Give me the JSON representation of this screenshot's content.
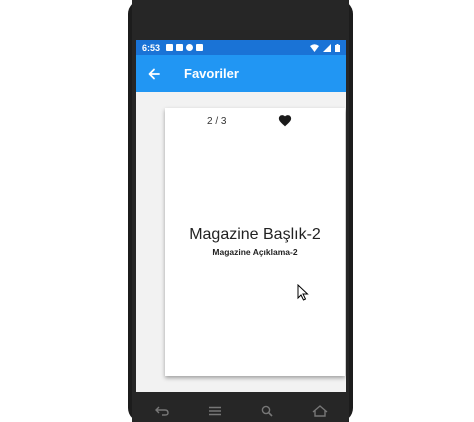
{
  "status_bar": {
    "time": "6:53",
    "icons_left": [
      "lock-icon",
      "gallery-icon",
      "sync-icon",
      "sim-icon"
    ],
    "icons_right": [
      "wifi-icon",
      "signal-icon",
      "battery-icon"
    ]
  },
  "app_bar": {
    "back_icon": "arrow-left-icon",
    "title": "Favoriler",
    "color": "#2196f3"
  },
  "card": {
    "page_counter": "2 / 3",
    "favorite_icon": "heart-icon",
    "title": "Magazine Başlık-2",
    "description": "Magazine Açıklama-2"
  },
  "nav_bar": {
    "buttons": [
      "back-icon",
      "menu-icon",
      "search-icon",
      "home-icon"
    ]
  }
}
